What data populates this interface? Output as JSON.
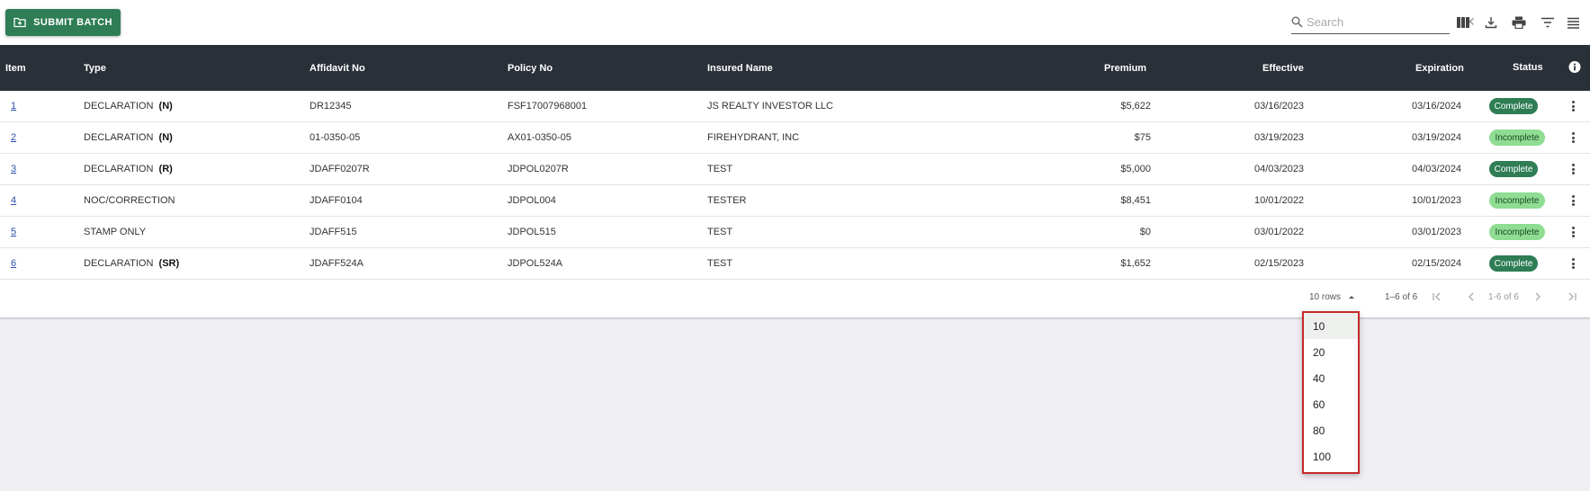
{
  "toolbar": {
    "submit_label": "SUBMIT BATCH",
    "search_placeholder": "Search",
    "icons": [
      "columns-icon",
      "download-icon",
      "print-icon",
      "filter-icon",
      "density-icon"
    ]
  },
  "table": {
    "columns": {
      "item": "Item",
      "type": "Type",
      "affidavit": "Affidavit No",
      "policy": "Policy No",
      "insured": "Insured Name",
      "premium": "Premium",
      "effective": "Effective",
      "expiration": "Expiration",
      "status": "Status"
    },
    "rows": [
      {
        "item": "1",
        "type": "DECLARATION",
        "code": "(N)",
        "affidavit": "DR12345",
        "policy": "FSF17007968001",
        "insured": "JS REALTY INVESTOR LLC",
        "premium": "$5,622",
        "effective": "03/16/2023",
        "expiration": "03/16/2024",
        "status": "Complete"
      },
      {
        "item": "2",
        "type": "DECLARATION",
        "code": "(N)",
        "affidavit": "01-0350-05",
        "policy": "AX01-0350-05",
        "insured": "FIREHYDRANT, INC",
        "premium": "$75",
        "effective": "03/19/2023",
        "expiration": "03/19/2024",
        "status": "Incomplete"
      },
      {
        "item": "3",
        "type": "DECLARATION",
        "code": "(R)",
        "affidavit": "JDAFF0207R",
        "policy": "JDPOL0207R",
        "insured": "TEST",
        "premium": "$5,000",
        "effective": "04/03/2023",
        "expiration": "04/03/2024",
        "status": "Complete"
      },
      {
        "item": "4",
        "type": "NOC/CORRECTION",
        "code": "",
        "affidavit": "JDAFF0104",
        "policy": "JDPOL004",
        "insured": "TESTER",
        "premium": "$8,451",
        "effective": "10/01/2022",
        "expiration": "10/01/2023",
        "status": "Incomplete"
      },
      {
        "item": "5",
        "type": "STAMP ONLY",
        "code": "",
        "affidavit": "JDAFF515",
        "policy": "JDPOL515",
        "insured": "TEST",
        "premium": "$0",
        "effective": "03/01/2022",
        "expiration": "03/01/2023",
        "status": "Incomplete"
      },
      {
        "item": "6",
        "type": "DECLARATION",
        "code": "(SR)",
        "affidavit": "JDAFF524A",
        "policy": "JDPOL524A",
        "insured": "TEST",
        "premium": "$1,652",
        "effective": "02/15/2023",
        "expiration": "02/15/2024",
        "status": "Complete"
      }
    ]
  },
  "pagination": {
    "rows_label": "10 rows",
    "range_label": "1–6 of 6",
    "page_label": "1-6 of 6"
  },
  "rows_menu": {
    "options": [
      "10",
      "20",
      "40",
      "60",
      "80",
      "100"
    ],
    "selected": "10"
  },
  "colors": {
    "complete": "#2e7d55",
    "incomplete": "#8fdc93",
    "header_bg": "#2a3038",
    "highlight": "#c62828"
  }
}
